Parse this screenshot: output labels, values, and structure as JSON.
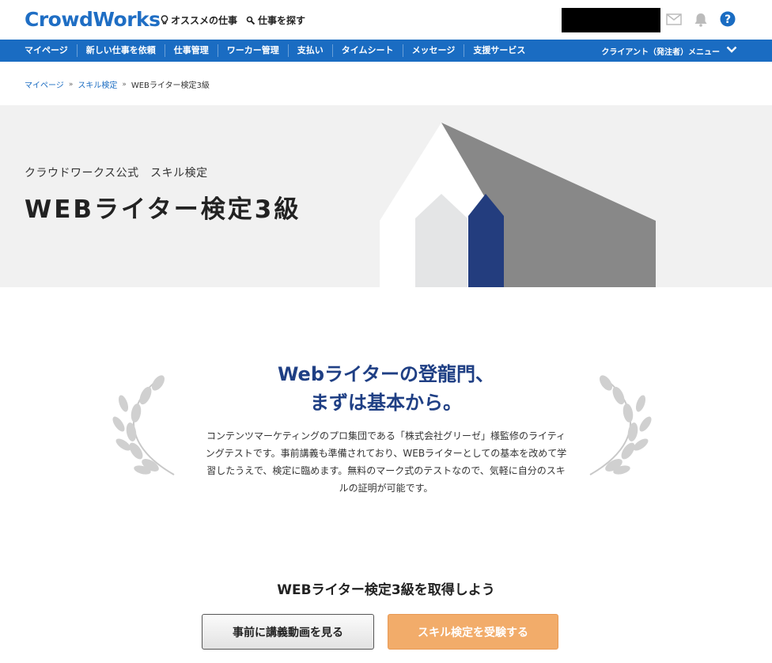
{
  "header": {
    "logo": "CrowdWorks",
    "recommended_jobs": "オススメの仕事",
    "find_jobs": "仕事を探す"
  },
  "nav": {
    "items": [
      {
        "label": "マイページ"
      },
      {
        "label": "新しい仕事を依頼"
      },
      {
        "label": "仕事管理"
      },
      {
        "label": "ワーカー管理"
      },
      {
        "label": "支払い"
      },
      {
        "label": "タイムシート"
      },
      {
        "label": "メッセージ"
      },
      {
        "label": "支援サービス"
      }
    ],
    "client_menu": "クライアント（発注者）メニュー"
  },
  "breadcrumb": {
    "home": "マイページ",
    "skill": "スキル検定",
    "current": "WEBライター検定3級"
  },
  "hero": {
    "subtitle": "クラウドワークス公式　スキル検定",
    "title": "WEBライター検定3級"
  },
  "intro": {
    "title_line1": "Webライターの登龍門、",
    "title_line2": "まずは基本から。",
    "text": "コンテンツマーケティングのプロ集団である「株式会社グリーゼ」様監修のライティングテストです。事前講義も準備されており、WEBライターとしての基本を改めて学習したうえで、検定に臨めます。無料のマーク式のテストなので、気軽に自分のスキルの証明が可能です。"
  },
  "cta": {
    "title": "WEBライター検定3級を取得しよう",
    "video_button": "事前に講義動画を見る",
    "exam_button": "スキル検定を受験する"
  },
  "colors": {
    "brand_blue": "#1a6cc2",
    "navy": "#1f3f84",
    "orange": "#f2ac6a"
  },
  "icons": {
    "recommended": "lightbulb-icon",
    "search": "search-icon",
    "mail": "mail-icon",
    "bell": "bell-icon",
    "help": "help-icon",
    "chevron": "chevron-down-icon"
  }
}
